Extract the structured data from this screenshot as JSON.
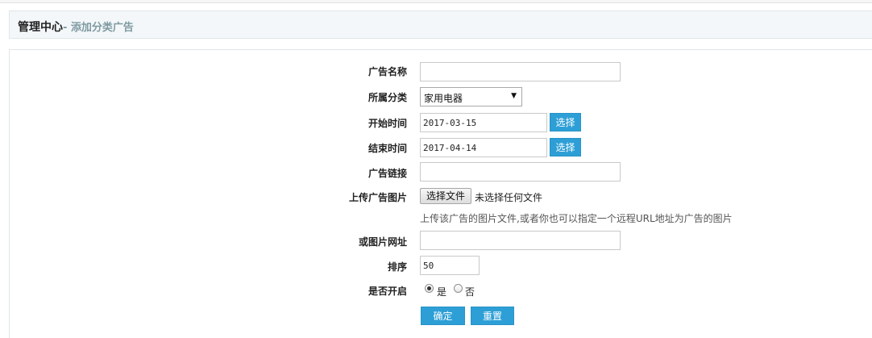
{
  "header": {
    "title": "管理中心",
    "subtitle": "- 添加分类广告"
  },
  "form": {
    "ad_name": {
      "label": "广告名称",
      "value": ""
    },
    "category": {
      "label": "所属分类",
      "value": "家用电器"
    },
    "start_time": {
      "label": "开始时间",
      "value": "2017-03-15",
      "button": "选择"
    },
    "end_time": {
      "label": "结束时间",
      "value": "2017-04-14",
      "button": "选择"
    },
    "ad_link": {
      "label": "广告链接",
      "value": ""
    },
    "upload_image": {
      "label": "上传广告图片",
      "button": "选择文件",
      "status": "未选择任何文件",
      "hint": "上传该广告的图片文件,或者你也可以指定一个远程URL地址为广告的图片"
    },
    "image_url": {
      "label": "或图片网址",
      "value": ""
    },
    "sort": {
      "label": "排序",
      "value": "50"
    },
    "enabled": {
      "label": "是否开启",
      "options": [
        {
          "label": "是",
          "checked": true
        },
        {
          "label": "否",
          "checked": false
        }
      ]
    },
    "submit_label": "确定",
    "reset_label": "重置"
  },
  "colors": {
    "accent": "#2d9fd6",
    "title_bar_bg": "#f3f7f9",
    "subtitle": "#7f9aa2"
  }
}
